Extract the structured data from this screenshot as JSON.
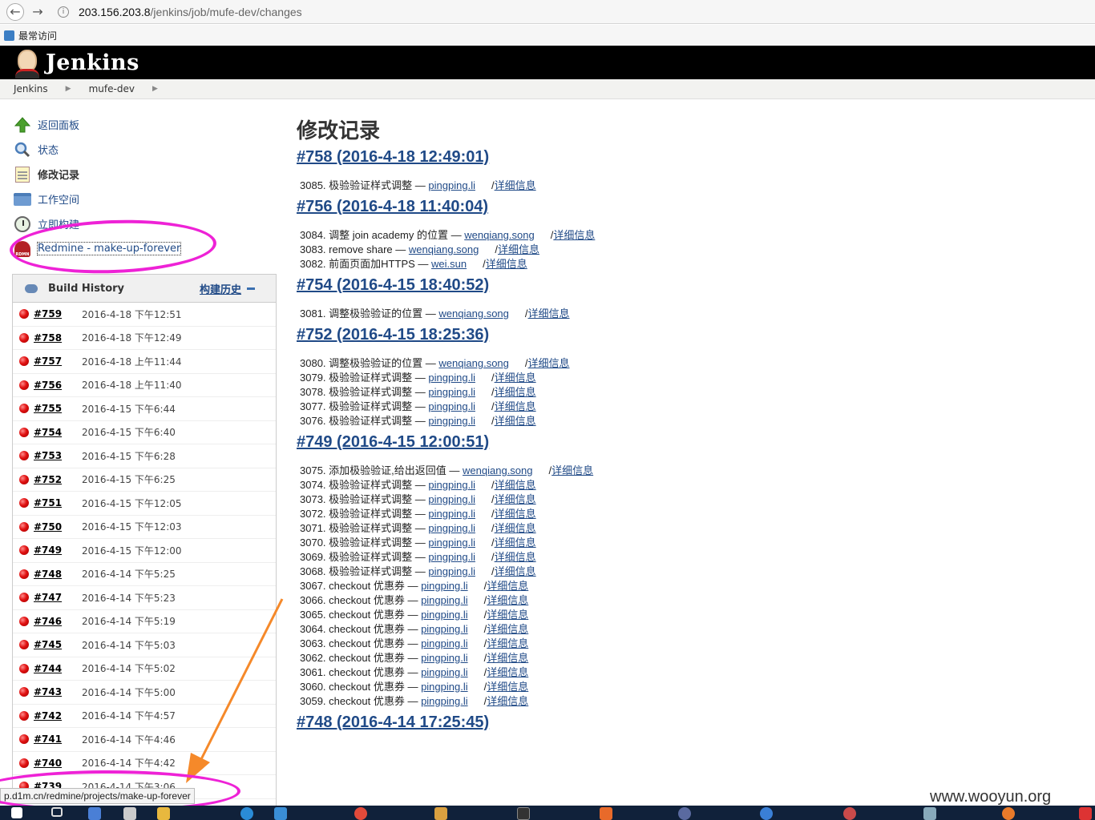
{
  "browser": {
    "url_host": "203.156.203.8",
    "url_path": "/jenkins/job/mufe-dev/changes",
    "bookmark_label": "最常访问"
  },
  "header": {
    "logo_text": "Jenkins"
  },
  "breadcrumb": [
    "Jenkins",
    "mufe-dev"
  ],
  "tasks": [
    {
      "label": "返回面板",
      "icon": "up-arrow-icon"
    },
    {
      "label": "状态",
      "icon": "search-icon"
    },
    {
      "label": "修改记录",
      "icon": "notepad-icon"
    },
    {
      "label": "工作空间",
      "icon": "folder-icon"
    },
    {
      "label": "立即构建",
      "icon": "clock-icon"
    },
    {
      "label": "Redmine - make-up-forever",
      "icon": "redmine-icon"
    }
  ],
  "build_history": {
    "title": "Build History",
    "trend_label": "构建历史",
    "rows": [
      {
        "num": "#759",
        "date": "2016-4-18 下午12:51"
      },
      {
        "num": "#758",
        "date": "2016-4-18 下午12:49"
      },
      {
        "num": "#757",
        "date": "2016-4-18 上午11:44"
      },
      {
        "num": "#756",
        "date": "2016-4-18 上午11:40"
      },
      {
        "num": "#755",
        "date": "2016-4-15 下午6:44"
      },
      {
        "num": "#754",
        "date": "2016-4-15 下午6:40"
      },
      {
        "num": "#753",
        "date": "2016-4-15 下午6:28"
      },
      {
        "num": "#752",
        "date": "2016-4-15 下午6:25"
      },
      {
        "num": "#751",
        "date": "2016-4-15 下午12:05"
      },
      {
        "num": "#750",
        "date": "2016-4-15 下午12:03"
      },
      {
        "num": "#749",
        "date": "2016-4-15 下午12:00"
      },
      {
        "num": "#748",
        "date": "2016-4-14 下午5:25"
      },
      {
        "num": "#747",
        "date": "2016-4-14 下午5:23"
      },
      {
        "num": "#746",
        "date": "2016-4-14 下午5:19"
      },
      {
        "num": "#745",
        "date": "2016-4-14 下午5:03"
      },
      {
        "num": "#744",
        "date": "2016-4-14 下午5:02"
      },
      {
        "num": "#743",
        "date": "2016-4-14 下午5:00"
      },
      {
        "num": "#742",
        "date": "2016-4-14 下午4:57"
      },
      {
        "num": "#741",
        "date": "2016-4-14 下午4:46"
      },
      {
        "num": "#740",
        "date": "2016-4-14 下午4:42"
      },
      {
        "num": "#739",
        "date": "2016-4-14 下午3:06"
      }
    ]
  },
  "main": {
    "title": "修改记录",
    "detail_label": "详细信息",
    "builds": [
      {
        "heading": "#758 (2016-4-18 12:49:01)",
        "changes": [
          {
            "id": "3085.",
            "msg": "极验验证样式调整",
            "author": "pingping.li"
          }
        ]
      },
      {
        "heading": "#756 (2016-4-18 11:40:04)",
        "changes": [
          {
            "id": "3084.",
            "msg": "调整 join academy 的位置",
            "author": "wenqiang.song"
          },
          {
            "id": "3083.",
            "msg": "remove share",
            "author": "wenqiang.song"
          },
          {
            "id": "3082.",
            "msg": "前面页面加HTTPS",
            "author": "wei.sun"
          }
        ]
      },
      {
        "heading": "#754 (2016-4-15 18:40:52)",
        "changes": [
          {
            "id": "3081.",
            "msg": "调整极验验证的位置",
            "author": "wenqiang.song"
          }
        ]
      },
      {
        "heading": "#752 (2016-4-15 18:25:36)",
        "changes": [
          {
            "id": "3080.",
            "msg": "调整极验验证的位置",
            "author": "wenqiang.song"
          },
          {
            "id": "3079.",
            "msg": "极验验证样式调整",
            "author": "pingping.li"
          },
          {
            "id": "3078.",
            "msg": "极验验证样式调整",
            "author": "pingping.li"
          },
          {
            "id": "3077.",
            "msg": "极验验证样式调整",
            "author": "pingping.li"
          },
          {
            "id": "3076.",
            "msg": "极验验证样式调整",
            "author": "pingping.li"
          }
        ]
      },
      {
        "heading": "#749 (2016-4-15 12:00:51)",
        "changes": [
          {
            "id": "3075.",
            "msg": "添加极验验证,给出返回值",
            "author": "wenqiang.song"
          },
          {
            "id": "3074.",
            "msg": "极验验证样式调整",
            "author": "pingping.li"
          },
          {
            "id": "3073.",
            "msg": "极验验证样式调整",
            "author": "pingping.li"
          },
          {
            "id": "3072.",
            "msg": "极验验证样式调整",
            "author": "pingping.li"
          },
          {
            "id": "3071.",
            "msg": "极验验证样式调整",
            "author": "pingping.li"
          },
          {
            "id": "3070.",
            "msg": "极验验证样式调整",
            "author": "pingping.li"
          },
          {
            "id": "3069.",
            "msg": "极验验证样式调整",
            "author": "pingping.li"
          },
          {
            "id": "3068.",
            "msg": "极验验证样式调整",
            "author": "pingping.li"
          },
          {
            "id": "3067.",
            "msg": "checkout 优惠券",
            "author": "pingping.li"
          },
          {
            "id": "3066.",
            "msg": "checkout 优惠券",
            "author": "pingping.li"
          },
          {
            "id": "3065.",
            "msg": "checkout 优惠券",
            "author": "pingping.li"
          },
          {
            "id": "3064.",
            "msg": "checkout 优惠券",
            "author": "pingping.li"
          },
          {
            "id": "3063.",
            "msg": "checkout 优惠券",
            "author": "pingping.li"
          },
          {
            "id": "3062.",
            "msg": "checkout 优惠券",
            "author": "pingping.li"
          },
          {
            "id": "3061.",
            "msg": "checkout 优惠券",
            "author": "pingping.li"
          },
          {
            "id": "3060.",
            "msg": "checkout 优惠券",
            "author": "pingping.li"
          },
          {
            "id": "3059.",
            "msg": "checkout 优惠券",
            "author": "pingping.li"
          }
        ]
      },
      {
        "heading": "#748 (2016-4-14 17:25:45)",
        "changes": []
      }
    ]
  },
  "status_bar": {
    "url": "p.d1m.cn/redmine/projects/make-up-forever"
  },
  "watermark": "www.wooyun.org",
  "colors": {
    "annotation": "#ee22d6",
    "arrow": "#f5892a",
    "link": "#204a87"
  }
}
